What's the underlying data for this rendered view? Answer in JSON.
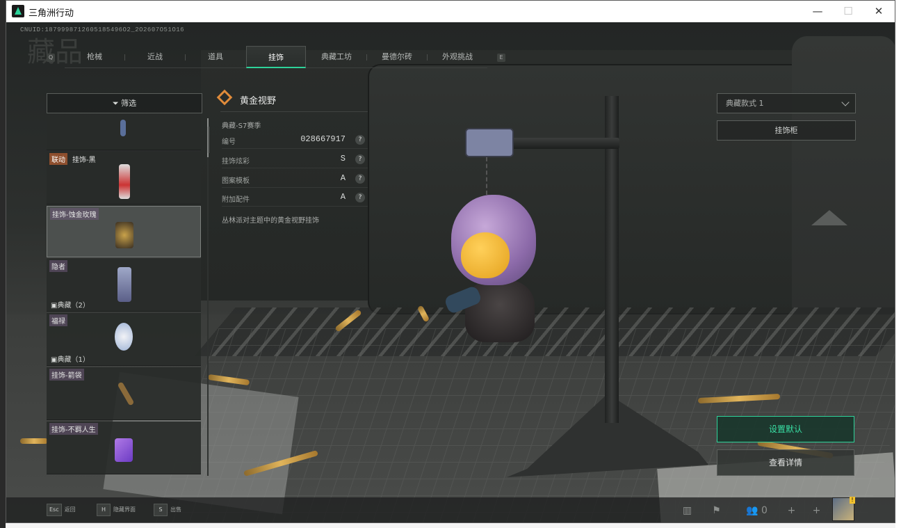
{
  "window": {
    "title": "三角洲行动",
    "minimize_glyph": "—",
    "maximize_glyph": "☐",
    "close_glyph": "✕"
  },
  "header": {
    "cnuid": "CNUID:1879998712605185496O2_2O2607O51O16",
    "watermark": "藏品",
    "key_left": "Q",
    "key_right": "E"
  },
  "tabs": [
    {
      "label": "枪械",
      "active": false
    },
    {
      "label": "近战",
      "active": false
    },
    {
      "label": "道具",
      "active": false
    },
    {
      "label": "挂饰",
      "active": true
    },
    {
      "label": "典藏工坊",
      "active": false
    },
    {
      "label": "曼德尔砖",
      "active": false
    },
    {
      "label": "外观挑战",
      "active": false
    }
  ],
  "sidebar": {
    "filter_label": "筛选",
    "items": [
      {
        "tag": "",
        "collect": "",
        "selected": false
      },
      {
        "linked": "联动",
        "tag": "挂饰-黑",
        "collect": "",
        "selected": false
      },
      {
        "tag": "挂饰-蚀金玫瑰",
        "collect": "",
        "selected": true
      },
      {
        "tag": "隐者",
        "collect": "典藏（2）",
        "selected": false
      },
      {
        "tag": "福禄",
        "collect": "典藏（1）",
        "selected": false
      },
      {
        "tag": "挂饰-箭袋",
        "collect": "",
        "selected": false
      },
      {
        "tag": "挂饰-不羁人生",
        "collect": "",
        "selected": false
      }
    ]
  },
  "detail": {
    "title": "黄金视野",
    "season": "典藏-S7赛季",
    "rows": [
      {
        "label": "编号",
        "value": "028667917"
      },
      {
        "label": "挂饰炫彩",
        "value": "S"
      },
      {
        "label": "图案模板",
        "value": "A"
      },
      {
        "label": "附加配件",
        "value": "A"
      }
    ],
    "description": "丛林派对主题中的黄金视野挂饰",
    "help_glyph": "?"
  },
  "right_panel": {
    "style_select_value": "典藏款式 1",
    "rack_button": "挂饰柜",
    "set_default_button": "设置默认",
    "view_detail_button": "查看详情"
  },
  "footer": {
    "hints": [
      {
        "key": "Esc",
        "label": "返回"
      },
      {
        "key": "H",
        "label": "隐藏界面"
      },
      {
        "key": "S",
        "label": "出售"
      }
    ],
    "friends_count": "0",
    "plus_glyph": "+",
    "avatar_badge": "!"
  },
  "colors": {
    "accent": "#2ed39a",
    "linked_tag": "#8e4f2e",
    "diamond": "#e08b3a"
  }
}
